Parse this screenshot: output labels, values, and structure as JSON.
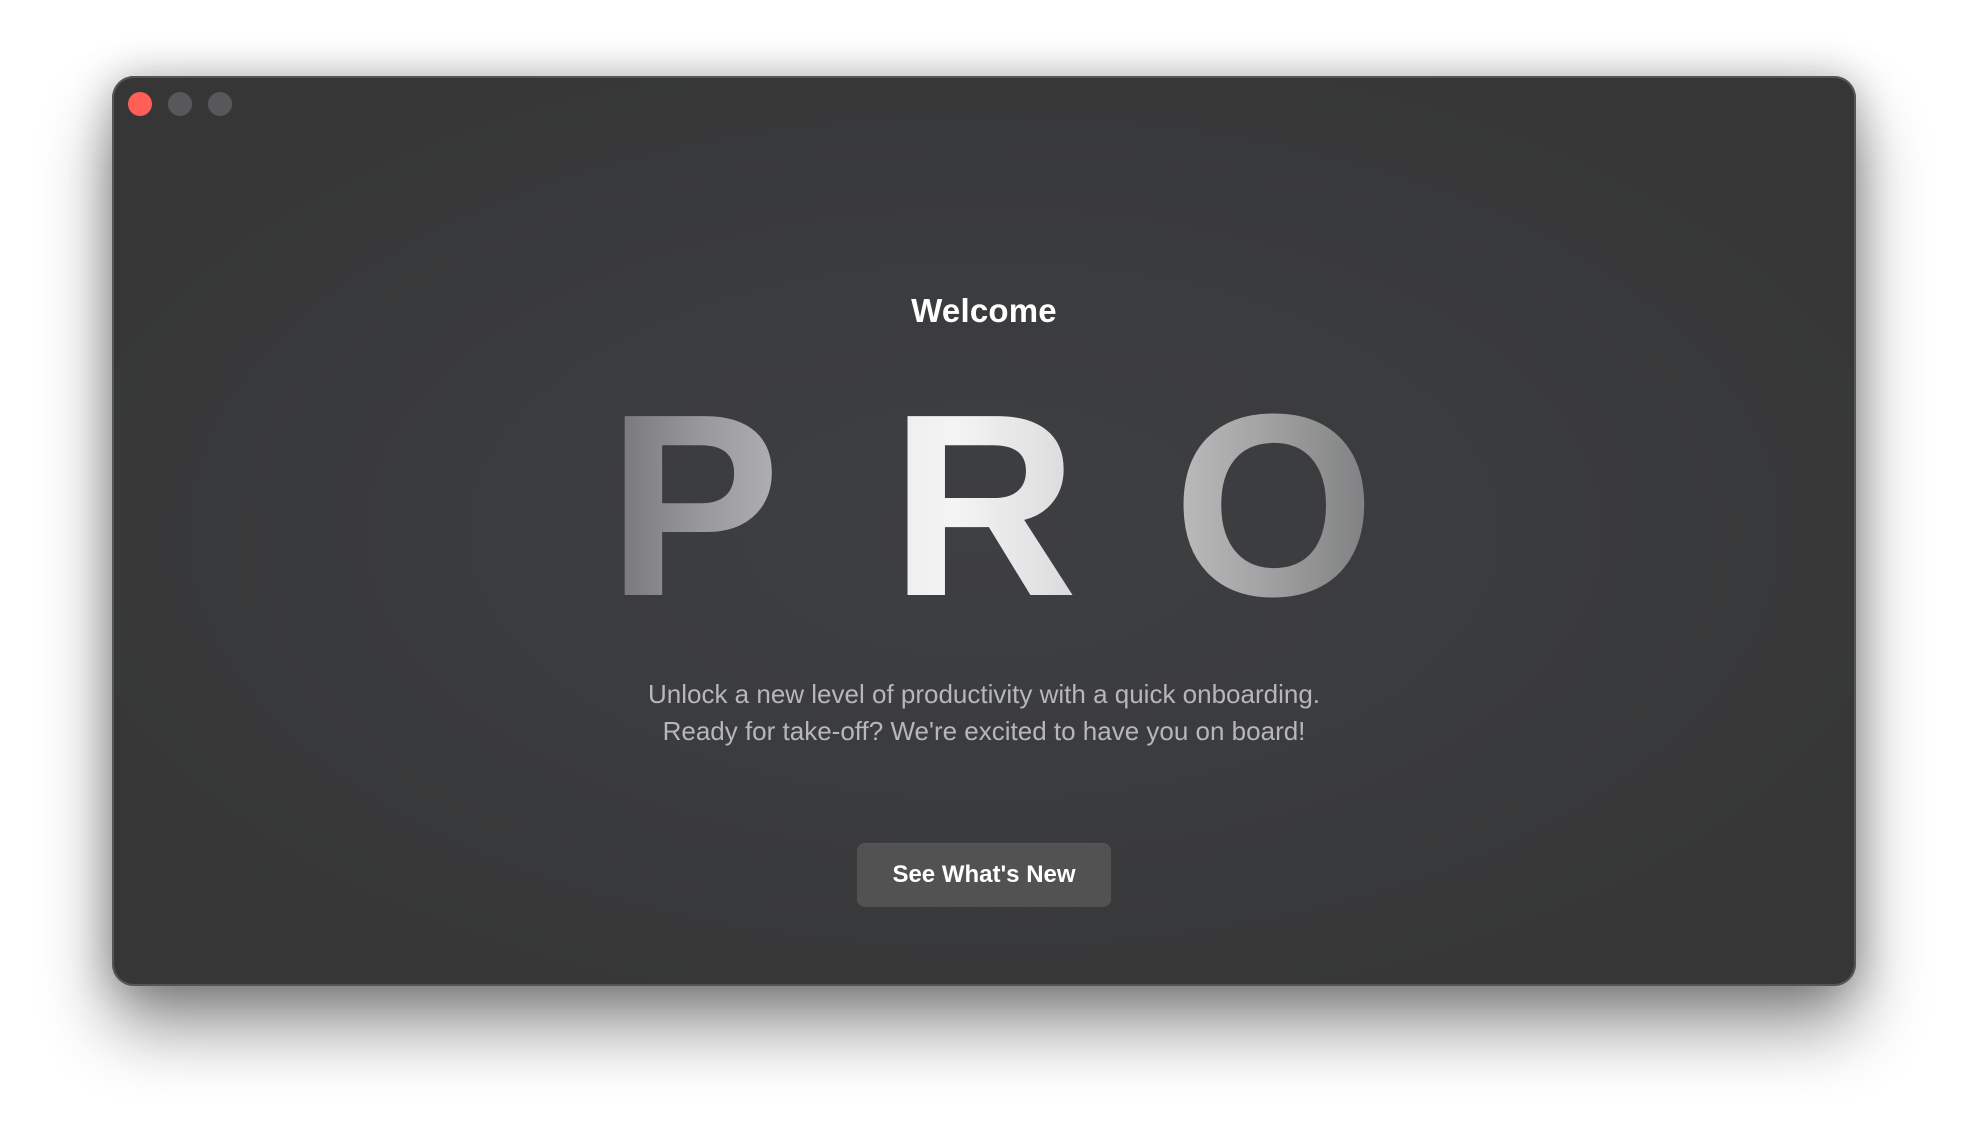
{
  "window": {
    "traffic_lights": [
      {
        "name": "close",
        "color": "#ff5f57"
      },
      {
        "name": "minimize",
        "color": "#58585a"
      },
      {
        "name": "zoom",
        "color": "#58585a"
      }
    ]
  },
  "main": {
    "heading": "Welcome",
    "hero_letters": [
      "P",
      "R",
      "O"
    ],
    "description_line1": "Unlock a new level of productivity with a quick onboarding.",
    "description_line2": "Ready for take-off? We're excited to have you on board!",
    "cta_label": "See What's New"
  },
  "colors": {
    "window_background": "#3a3b3d",
    "button_background": "#525253",
    "text_primary": "#ffffff",
    "text_secondary": "#b7b7b9"
  }
}
